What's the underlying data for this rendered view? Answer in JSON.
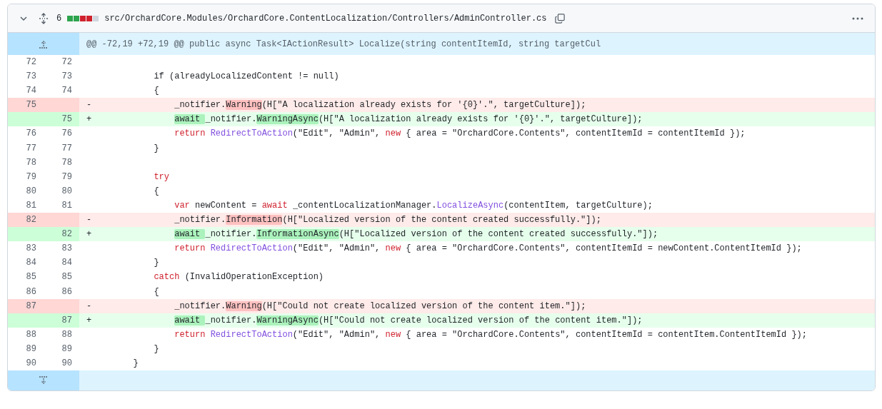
{
  "file_header": {
    "expanded": true,
    "changes": "6",
    "diffstat": [
      {
        "color": "#2da44e"
      },
      {
        "color": "#2da44e"
      },
      {
        "color": "#cf222e"
      },
      {
        "color": "#cf222e"
      },
      {
        "color": "#d0d7de"
      }
    ],
    "path": "src/OrchardCore.Modules/OrchardCore.ContentLocalization/Controllers/AdminController.cs"
  },
  "hunk_header": "@@ -72,19 +72,19 @@ public async Task<IActionResult> Localize(string contentItemId, string targetCul",
  "rows": [
    {
      "kind": "context",
      "old": "72",
      "new": "72"
    },
    {
      "kind": "context",
      "old": "73",
      "new": "73",
      "code": [
        {
          "text": "            if (alreadyLocalizedContent != null)",
          "kind": "plain"
        }
      ]
    },
    {
      "kind": "context",
      "old": "74",
      "new": "74",
      "code": [
        {
          "text": "            {",
          "kind": "plain"
        }
      ]
    },
    {
      "kind": "deletion",
      "old": "75",
      "marker": "-",
      "code": [
        {
          "text": "                _notifier.",
          "kind": "plain"
        },
        {
          "text": "Warning",
          "kind": "plain",
          "emph": true
        },
        {
          "text": "(H[\"A localization already exists for '{0}'.\", targetCulture]);",
          "kind": "plain"
        }
      ]
    },
    {
      "kind": "addition",
      "new": "75",
      "marker": "+",
      "code": [
        {
          "text": "                await ",
          "kind": "plain",
          "emph": true
        },
        {
          "text": "_notifier.",
          "kind": "plain"
        },
        {
          "text": "WarningAsync",
          "kind": "plain",
          "emph": true
        },
        {
          "text": "(H[\"A localization already exists for '{0}'.\", targetCulture]);",
          "kind": "plain"
        }
      ]
    },
    {
      "kind": "context",
      "old": "76",
      "new": "76",
      "code": [
        {
          "text": "                return",
          "kind": "keyword"
        },
        {
          "text": " RedirectToAction",
          "kind": "entity"
        },
        {
          "text": "(\"Edit\", \"Admin\", ",
          "kind": "plain"
        },
        {
          "text": "new",
          "kind": "keyword"
        },
        {
          "text": " { area = \"OrchardCore.Contents\", contentItemId = contentItemId });",
          "kind": "plain"
        }
      ]
    },
    {
      "kind": "context",
      "old": "77",
      "new": "77",
      "code": [
        {
          "text": "            }",
          "kind": "plain"
        }
      ]
    },
    {
      "kind": "context",
      "old": "78",
      "new": "78"
    },
    {
      "kind": "context",
      "old": "79",
      "new": "79",
      "code": [
        {
          "text": "            try",
          "kind": "keyword"
        }
      ]
    },
    {
      "kind": "context",
      "old": "80",
      "new": "80",
      "code": [
        {
          "text": "            {",
          "kind": "plain"
        }
      ]
    },
    {
      "kind": "context",
      "old": "81",
      "new": "81",
      "code": [
        {
          "text": "                var",
          "kind": "keyword"
        },
        {
          "text": " newContent = ",
          "kind": "plain"
        },
        {
          "text": "await",
          "kind": "keyword"
        },
        {
          "text": " _contentLocalizationManager.",
          "kind": "plain"
        },
        {
          "text": "LocalizeAsync",
          "kind": "entity"
        },
        {
          "text": "(contentItem, targetCulture);",
          "kind": "plain"
        }
      ]
    },
    {
      "kind": "deletion",
      "old": "82",
      "marker": "-",
      "code": [
        {
          "text": "                _notifier.",
          "kind": "plain"
        },
        {
          "text": "Information",
          "kind": "plain",
          "emph": true
        },
        {
          "text": "(H[\"Localized version of the content created successfully.\"]);",
          "kind": "plain"
        }
      ]
    },
    {
      "kind": "addition",
      "new": "82",
      "marker": "+",
      "code": [
        {
          "text": "                await ",
          "kind": "plain",
          "emph": true
        },
        {
          "text": "_notifier.",
          "kind": "plain"
        },
        {
          "text": "InformationAsync",
          "kind": "plain",
          "emph": true
        },
        {
          "text": "(H[\"Localized version of the content created successfully.\"]);",
          "kind": "plain"
        }
      ]
    },
    {
      "kind": "context",
      "old": "83",
      "new": "83",
      "code": [
        {
          "text": "                return",
          "kind": "keyword"
        },
        {
          "text": " RedirectToAction",
          "kind": "entity"
        },
        {
          "text": "(\"Edit\", \"Admin\", ",
          "kind": "plain"
        },
        {
          "text": "new",
          "kind": "keyword"
        },
        {
          "text": " { area = \"OrchardCore.Contents\", contentItemId = newContent.ContentItemId });",
          "kind": "plain"
        }
      ]
    },
    {
      "kind": "context",
      "old": "84",
      "new": "84",
      "code": [
        {
          "text": "            }",
          "kind": "plain"
        }
      ]
    },
    {
      "kind": "context",
      "old": "85",
      "new": "85",
      "code": [
        {
          "text": "            catch",
          "kind": "keyword"
        },
        {
          "text": " (InvalidOperationException)",
          "kind": "plain"
        }
      ]
    },
    {
      "kind": "context",
      "old": "86",
      "new": "86",
      "code": [
        {
          "text": "            {",
          "kind": "plain"
        }
      ]
    },
    {
      "kind": "deletion",
      "old": "87",
      "marker": "-",
      "code": [
        {
          "text": "                _notifier.",
          "kind": "plain"
        },
        {
          "text": "Warning",
          "kind": "plain",
          "emph": true
        },
        {
          "text": "(H[\"Could not create localized version of the content item.\"]);",
          "kind": "plain"
        }
      ]
    },
    {
      "kind": "addition",
      "new": "87",
      "marker": "+",
      "code": [
        {
          "text": "                await ",
          "kind": "plain",
          "emph": true
        },
        {
          "text": "_notifier.",
          "kind": "plain"
        },
        {
          "text": "WarningAsync",
          "kind": "plain",
          "emph": true
        },
        {
          "text": "(H[\"Could not create localized version of the content item.\"]);",
          "kind": "plain"
        }
      ]
    },
    {
      "kind": "context",
      "old": "88",
      "new": "88",
      "code": [
        {
          "text": "                return",
          "kind": "keyword"
        },
        {
          "text": " RedirectToAction",
          "kind": "entity"
        },
        {
          "text": "(\"Edit\", \"Admin\", ",
          "kind": "plain"
        },
        {
          "text": "new",
          "kind": "keyword"
        },
        {
          "text": " { area = \"OrchardCore.Contents\", contentItemId = contentItem.ContentItemId });",
          "kind": "plain"
        }
      ]
    },
    {
      "kind": "context",
      "old": "89",
      "new": "89",
      "code": [
        {
          "text": "            }",
          "kind": "plain"
        }
      ]
    },
    {
      "kind": "context",
      "old": "90",
      "new": "90",
      "code": [
        {
          "text": "        }",
          "kind": "plain"
        }
      ]
    }
  ]
}
